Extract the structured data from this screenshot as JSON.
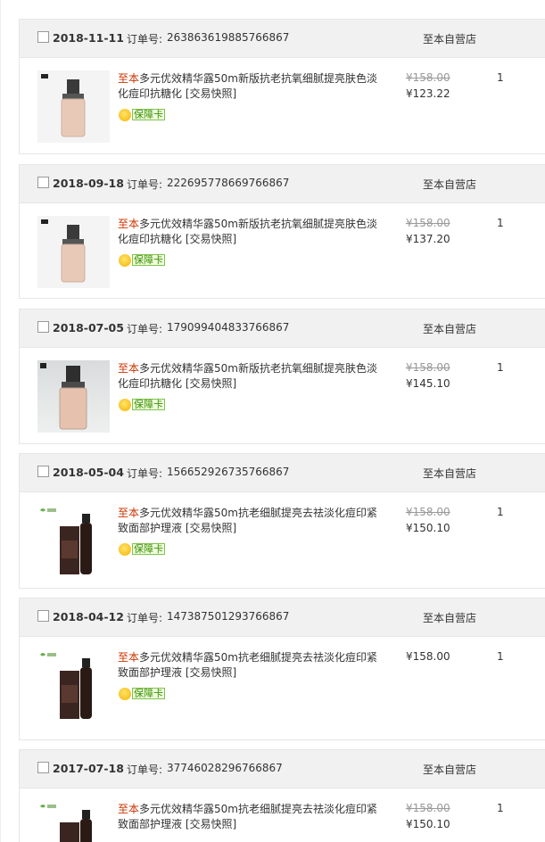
{
  "order_no_label": "订单号:",
  "shop_name": "至本自营店",
  "guarantee_label": "保障卡",
  "snapshot_label": "[交易快照]",
  "orders": [
    {
      "date": "2018-11-11",
      "order_no": "263863619885766867",
      "brand": "至本",
      "title": "多元优效精华露50m新版抗老抗氧细腻提亮肤色淡化痘印抗糖化",
      "price_old": "¥158.00",
      "price_new": "¥123.22",
      "qty": "1"
    },
    {
      "date": "2018-09-18",
      "order_no": "222695778669766867",
      "brand": "至本",
      "title": "多元优效精华露50m新版抗老抗氧细腻提亮肤色淡化痘印抗糖化",
      "price_old": "¥158.00",
      "price_new": "¥137.20",
      "qty": "1"
    },
    {
      "date": "2018-07-05",
      "order_no": "179099404833766867",
      "brand": "至本",
      "title": "多元优效精华露50m新版抗老抗氧细腻提亮肤色淡化痘印抗糖化",
      "price_old": "¥158.00",
      "price_new": "¥145.10",
      "qty": "1"
    },
    {
      "date": "2018-05-04",
      "order_no": "156652926735766867",
      "brand": "至本",
      "title": "多元优效精华露50m抗老细腻提亮去祛淡化痘印紧致面部护理液",
      "price_old": "¥158.00",
      "price_new": "¥150.10",
      "qty": "1"
    },
    {
      "date": "2018-04-12",
      "order_no": "147387501293766867",
      "brand": "至本",
      "title": "多元优效精华露50m抗老细腻提亮去祛淡化痘印紧致面部护理液",
      "price_old": "",
      "price_new": "¥158.00",
      "qty": "1"
    },
    {
      "date": "2017-07-18",
      "order_no": "37746028296766867",
      "brand": "至本",
      "title": "多元优效精华露50m抗老细腻提亮去祛淡化痘印紧致面部护理液",
      "price_old": "¥158.00",
      "price_new": "¥150.10",
      "qty": "1"
    }
  ]
}
